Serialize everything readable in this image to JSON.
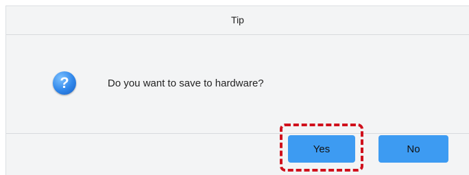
{
  "dialog": {
    "title": "Tip",
    "icon": "question-icon",
    "message": "Do you want to save to hardware?",
    "buttons": {
      "yes_label": "Yes",
      "no_label": "No"
    },
    "accent_color": "#3d9bf2",
    "highlight_color": "#d0101c"
  }
}
